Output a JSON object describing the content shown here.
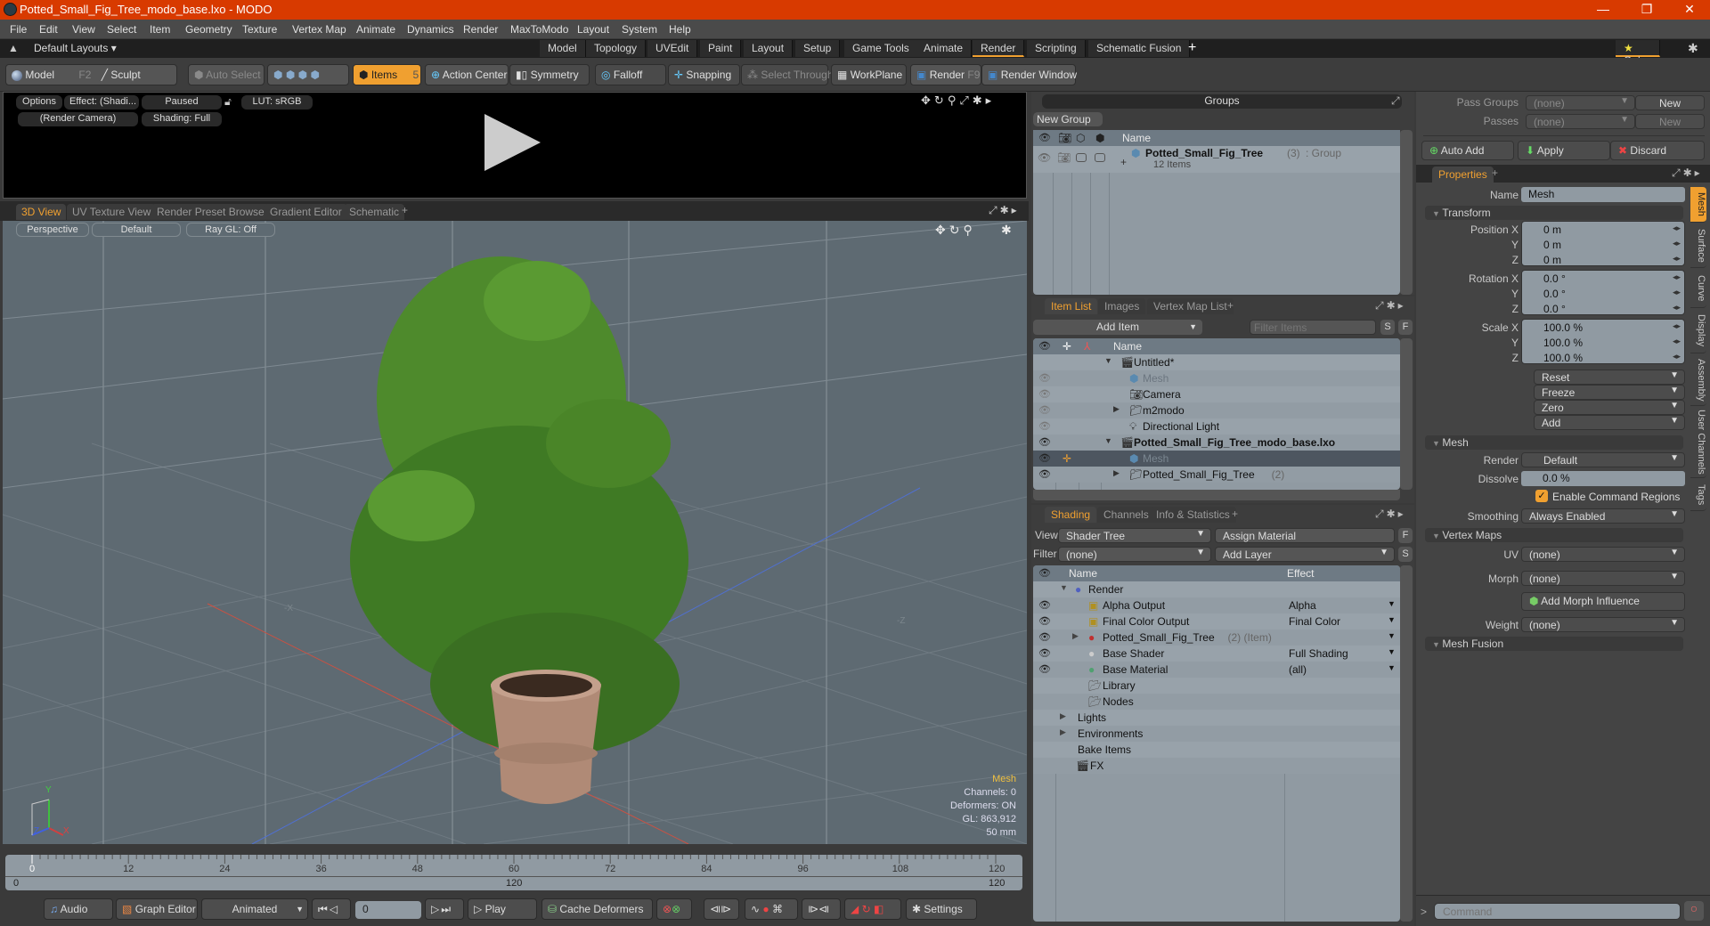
{
  "window": {
    "title": "Potted_Small_Fig_Tree_modo_base.lxo - MODO",
    "controls": [
      "—",
      "❐",
      "✕"
    ]
  },
  "menu": [
    "File",
    "Edit",
    "View",
    "Select",
    "Item",
    "Geometry",
    "Texture",
    "Vertex Map",
    "Animate",
    "Dynamics",
    "Render",
    "MaxToModo",
    "Layout",
    "System",
    "Help"
  ],
  "layouts": {
    "default_label": "Default Layouts ▾",
    "tabs": [
      "Model",
      "Topology",
      "UVEdit",
      "Paint",
      "Layout",
      "Setup",
      "Game Tools",
      "Animate",
      "Render",
      "Scripting",
      "Schematic Fusion"
    ],
    "active_tab": "Render",
    "add": "+",
    "only_label": "Only"
  },
  "toolbar": {
    "model": "Model",
    "model_key": "F2",
    "sculpt": "Sculpt",
    "auto_select": "Auto Select",
    "items": "Items",
    "items_count": "5",
    "action_center": "Action Center",
    "symmetry": "Symmetry",
    "falloff": "Falloff",
    "snapping": "Snapping",
    "select_through": "Select Through",
    "workplane": "WorkPlane",
    "render": "Render",
    "render_key": "F9",
    "render_window": "Render Window"
  },
  "render_preview": {
    "options": "Options",
    "effect": "Effect: (Shadi...",
    "paused": "Paused",
    "lut": "LUT: sRGB",
    "camera": "(Render Camera)",
    "shading": "Shading: Full"
  },
  "view_tabs": {
    "tabs": [
      "3D View",
      "UV Texture View",
      "Render Preset Browser",
      "Gradient Editor",
      "Schematic"
    ],
    "active": "3D View",
    "add": "+"
  },
  "viewport": {
    "projection": "Perspective",
    "style": "Default",
    "raygl": "Ray GL: Off",
    "axis_neg_x": "-X",
    "axis_neg_z": "-Z",
    "info": {
      "selection": "Mesh",
      "channels": "Channels: 0",
      "deformers": "Deformers: ON",
      "gl": "GL: 863,912",
      "focal": "50 mm"
    },
    "gizmo": {
      "x": "X",
      "y": "Y",
      "z": "Z"
    }
  },
  "timeline": {
    "ticks": [
      "0",
      "12",
      "24",
      "36",
      "48",
      "60",
      "72",
      "84",
      "96",
      "108",
      "120"
    ],
    "range_start": "0",
    "range_mid": "120",
    "range_end": "120"
  },
  "transport": {
    "audio": "Audio",
    "graph_editor": "Graph Editor",
    "animated": "Animated",
    "frame": "0",
    "play": "Play",
    "cache_deformers": "Cache Deformers",
    "settings": "Settings"
  },
  "groups": {
    "title": "Groups",
    "new_group": "New Group",
    "col_name": "Name",
    "item_name": "Potted_Small_Fig_Tree",
    "item_count": "(3)",
    "item_type": ": Group",
    "item_sub": "12 Items"
  },
  "item_list": {
    "tabs": [
      "Item List",
      "Images",
      "Vertex Map List"
    ],
    "active": "Item List",
    "add_item": "Add Item",
    "filter_placeholder": "Filter Items",
    "s_btn": "S",
    "f_btn": "F",
    "col_name": "Name",
    "rows": [
      {
        "name": "Untitled*",
        "indent": 0,
        "bold": false,
        "dim": false
      },
      {
        "name": "Mesh",
        "indent": 1,
        "bold": false,
        "dim": true
      },
      {
        "name": "Camera",
        "indent": 1,
        "bold": false,
        "dim": false
      },
      {
        "name": "m2modo",
        "indent": 1,
        "bold": false,
        "dim": false
      },
      {
        "name": "Directional Light",
        "indent": 1,
        "bold": false,
        "dim": false
      },
      {
        "name": "Potted_Small_Fig_Tree_modo_base.lxo",
        "indent": 0,
        "bold": true,
        "dim": false
      },
      {
        "name": "Mesh",
        "indent": 1,
        "bold": false,
        "dim": true,
        "selected": true
      },
      {
        "name": "Potted_Small_Fig_Tree",
        "suffix": "(2)",
        "indent": 1,
        "bold": false,
        "dim": false
      }
    ]
  },
  "shading": {
    "tabs": [
      "Shading",
      "Channels",
      "Info & Statistics"
    ],
    "active": "Shading",
    "view_label": "View",
    "view_value": "Shader Tree",
    "assign_material": "Assign Material",
    "filter_label": "Filter",
    "filter_value": "(none)",
    "add_layer": "Add Layer",
    "f_btn": "F",
    "s_btn": "S",
    "col_name": "Name",
    "col_effect": "Effect",
    "rows": [
      {
        "name": "Render",
        "effect": "",
        "indent": 0
      },
      {
        "name": "Alpha Output",
        "effect": "Alpha",
        "indent": 1
      },
      {
        "name": "Final Color Output",
        "effect": "Final Color",
        "indent": 1
      },
      {
        "name": "Potted_Small_Fig_Tree",
        "suffix": "(2) (Item)",
        "effect": "",
        "indent": 1
      },
      {
        "name": "Base Shader",
        "effect": "Full Shading",
        "indent": 1
      },
      {
        "name": "Base Material",
        "effect": "(all)",
        "indent": 1
      },
      {
        "name": "Library",
        "effect": "",
        "indent": 1
      },
      {
        "name": "Nodes",
        "effect": "",
        "indent": 1
      },
      {
        "name": "Lights",
        "effect": "",
        "indent": 0
      },
      {
        "name": "Environments",
        "effect": "",
        "indent": 0
      },
      {
        "name": "Bake Items",
        "effect": "",
        "indent": 0
      },
      {
        "name": "FX",
        "effect": "",
        "indent": 0
      }
    ]
  },
  "passes": {
    "pass_groups_label": "Pass Groups",
    "pass_groups_value": "(none)",
    "passes_label": "Passes",
    "passes_value": "(none)",
    "new": "New",
    "auto_add": "Auto Add",
    "apply": "Apply",
    "discard": "Discard"
  },
  "properties": {
    "tab": "Properties",
    "name_label": "Name",
    "name_value": "Mesh",
    "transform": "Transform",
    "position_label": "Position X",
    "rotation_label": "Rotation X",
    "scale_label": "Scale X",
    "y": "Y",
    "z": "Z",
    "position": [
      "0 m",
      "0 m",
      "0 m"
    ],
    "rotation": [
      "0.0 °",
      "0.0 °",
      "0.0 °"
    ],
    "scale": [
      "100.0 %",
      "100.0 %",
      "100.0 %"
    ],
    "actions": [
      "Reset",
      "Freeze",
      "Zero",
      "Add"
    ],
    "mesh_section": "Mesh",
    "render_label": "Render",
    "render_value": "Default",
    "dissolve_label": "Dissolve",
    "dissolve_value": "0.0 %",
    "command_regions": "Enable Command Regions",
    "smoothing_label": "Smoothing",
    "smoothing_value": "Always Enabled",
    "vertex_maps": "Vertex Maps",
    "uv_label": "UV",
    "uv_value": "(none)",
    "morph_label": "Morph",
    "morph_value": "(none)",
    "add_morph": "Add Morph Influence",
    "weight_label": "Weight",
    "weight_value": "(none)",
    "mesh_fusion": "Mesh Fusion",
    "side_tabs": [
      "Mesh",
      "Surface",
      "Curve",
      "Display",
      "Assembly",
      "User Channels",
      "Tags"
    ]
  },
  "command": {
    "prompt": ">",
    "placeholder": "Command"
  }
}
